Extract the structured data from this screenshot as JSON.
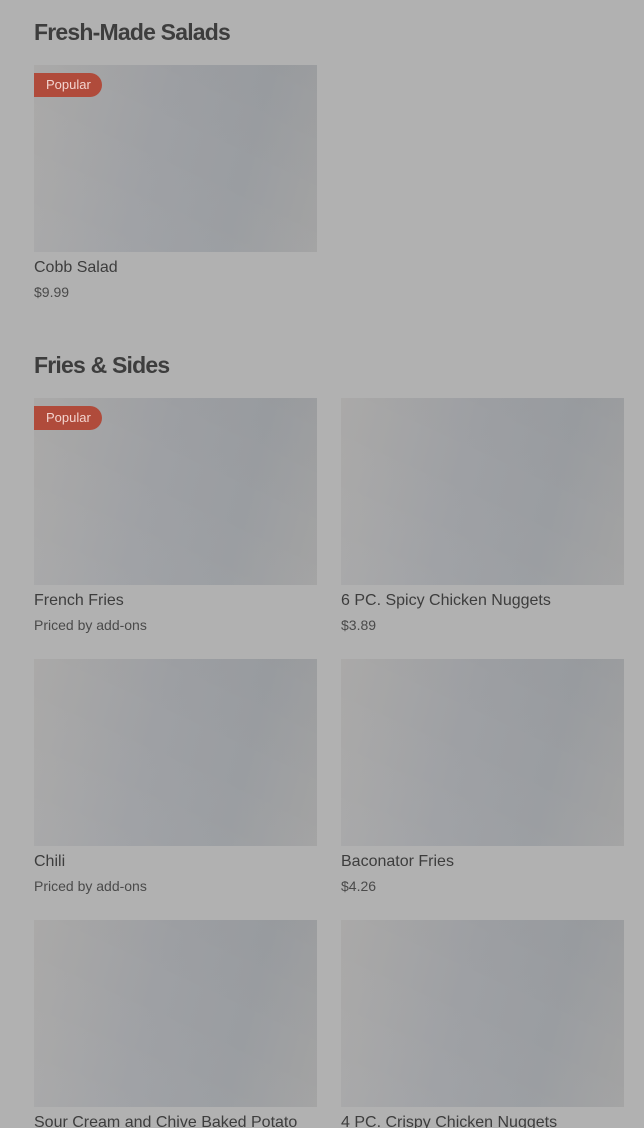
{
  "sections": [
    {
      "title": "Fresh-Made Salads",
      "items": [
        {
          "name": "Cobb Salad",
          "price": "$9.99",
          "badge": "Popular"
        }
      ]
    },
    {
      "title": "Fries & Sides",
      "items": [
        {
          "name": "French Fries",
          "price": "Priced by add-ons",
          "badge": "Popular"
        },
        {
          "name": "6 PC. Spicy Chicken Nuggets",
          "price": "$3.89",
          "badge": ""
        },
        {
          "name": "Chili",
          "price": "Priced by add-ons",
          "badge": ""
        },
        {
          "name": "Baconator Fries",
          "price": "$4.26",
          "badge": ""
        },
        {
          "name": "Sour Cream and Chive Baked Potato",
          "price": "",
          "badge": ""
        },
        {
          "name": "4 PC. Crispy Chicken Nuggets",
          "price": "",
          "badge": ""
        }
      ]
    }
  ],
  "colors": {
    "page_background": "#b1b1b1",
    "badge_background": "#b04b3b",
    "text": "#3d3d3d",
    "image_placeholder": "#9ea0a4"
  }
}
